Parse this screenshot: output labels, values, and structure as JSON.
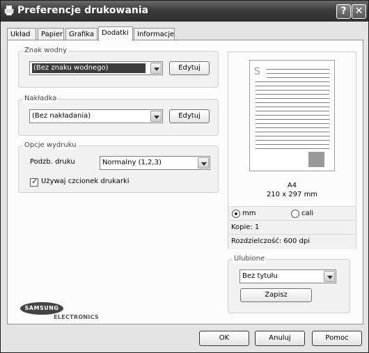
{
  "window": {
    "title": "Preferencje drukowania",
    "help_label": "?",
    "close_label": "✕"
  },
  "tabs": [
    {
      "label": "Układ",
      "active": false
    },
    {
      "label": "Papier",
      "active": false
    },
    {
      "label": "Grafika",
      "active": false
    },
    {
      "label": "Dodatki",
      "active": true
    },
    {
      "label": "Informacje",
      "active": false
    }
  ],
  "watermark": {
    "group_label": "Znak wodny",
    "selected": "(Bez znaku wodnego)",
    "edit_label": "Edytuj"
  },
  "overlay": {
    "group_label": "Nakładka",
    "selected": "(Bez nakładania)",
    "edit_label": "Edytuj"
  },
  "output_options": {
    "group_label": "Opcje wydruku",
    "subset_label": "Podzb. druku",
    "subset_selected": "Normalny (1,2,3)",
    "printer_fonts_label": "Używaj czcionek drukarki",
    "printer_fonts_checked": true
  },
  "preview": {
    "page_icon_letter": "S",
    "paper_name": "A4",
    "paper_dims": "210 x 297 mm",
    "unit_mm": "mm",
    "unit_inch": "cali",
    "selected_unit": "mm",
    "copies": "Kopie: 1",
    "resolution": "Rozdzielczość: 600 dpi"
  },
  "favorites": {
    "group_label": "Ulubione",
    "selected": "Bez tytułu",
    "save_label": "Zapisz"
  },
  "logo": {
    "brand": "SAMSUNG",
    "sub": "ELECTRONICS"
  },
  "buttons": {
    "ok": "OK",
    "cancel": "Anuluj",
    "help": "Pomoc"
  },
  "colors": {
    "title_bar": "#3c3c3c",
    "selection": "#3c3c3c"
  }
}
